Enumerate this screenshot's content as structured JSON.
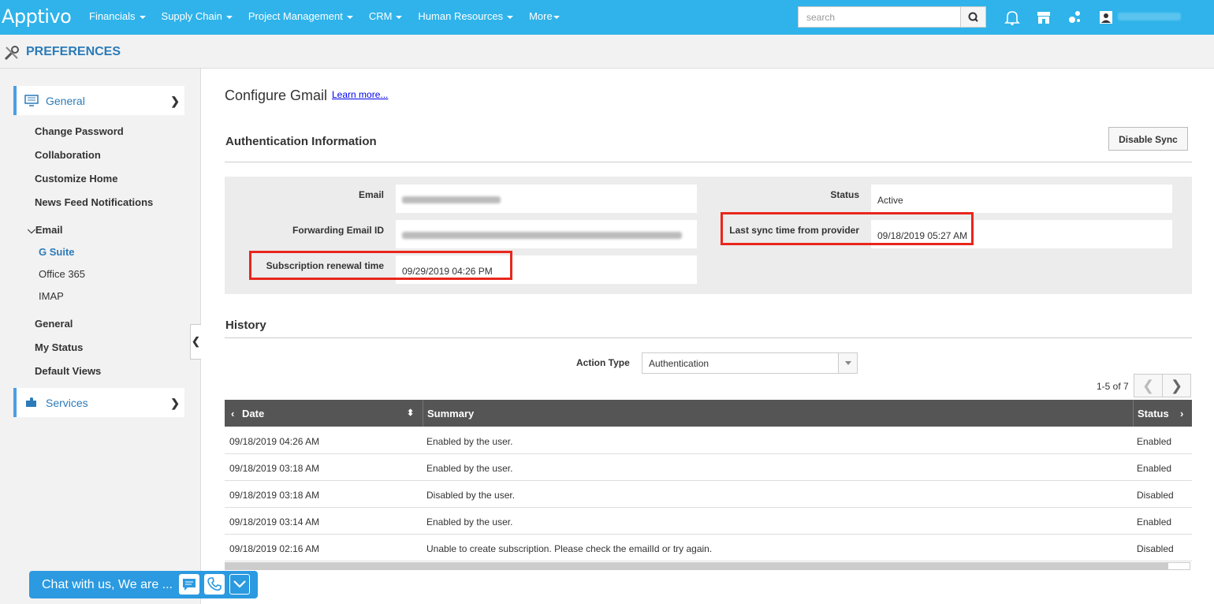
{
  "app": {
    "logo": "Apptivo"
  },
  "nav": {
    "items": [
      "Financials",
      "Supply Chain",
      "Project Management",
      "CRM",
      "Human Resources",
      "More"
    ]
  },
  "search": {
    "placeholder": "search"
  },
  "page": {
    "title": "PREFERENCES"
  },
  "sidebar": {
    "general_label": "General",
    "links": [
      "Change Password",
      "Collaboration",
      "Customize Home",
      "News Feed Notifications"
    ],
    "email_label": "Email",
    "email_items": [
      "G Suite",
      "Office 365",
      "IMAP"
    ],
    "links2": [
      "General",
      "My Status",
      "Default Views"
    ],
    "services_label": "Services"
  },
  "configure": {
    "title": "Configure Gmail",
    "learn_more": "Learn more..."
  },
  "auth": {
    "title": "Authentication Information",
    "disable_button": "Disable Sync",
    "email_label": "Email",
    "forwarding_label": "Forwarding Email ID",
    "renewal_label": "Subscription renewal time",
    "renewal_value": "09/29/2019 04:26 PM",
    "status_label": "Status",
    "status_value": "Active",
    "last_sync_label": "Last sync time from provider",
    "last_sync_value": "09/18/2019 05:27 AM"
  },
  "history": {
    "title": "History",
    "action_type_label": "Action Type",
    "action_type_value": "Authentication",
    "pagination": "1-5 of 7",
    "columns": [
      "Date",
      "Summary",
      "Status"
    ],
    "rows": [
      {
        "date": "09/18/2019 04:26 AM",
        "summary": "Enabled by the user.",
        "status": "Enabled"
      },
      {
        "date": "09/18/2019 03:18 AM",
        "summary": "Enabled by the user.",
        "status": "Enabled"
      },
      {
        "date": "09/18/2019 03:18 AM",
        "summary": "Disabled by the user.",
        "status": "Disabled"
      },
      {
        "date": "09/18/2019 03:14 AM",
        "summary": "Enabled by the user.",
        "status": "Enabled"
      },
      {
        "date": "09/18/2019 02:16 AM",
        "summary": "Unable to create subscription. Please check the emailId or try again.",
        "status": "Disabled"
      }
    ]
  },
  "chat": {
    "text": "Chat with us, We are ..."
  },
  "colors": {
    "topbar": "#2fb3ea",
    "accent": "#2b7bb9",
    "highlight": "#e8261c",
    "table_header": "#555555"
  }
}
